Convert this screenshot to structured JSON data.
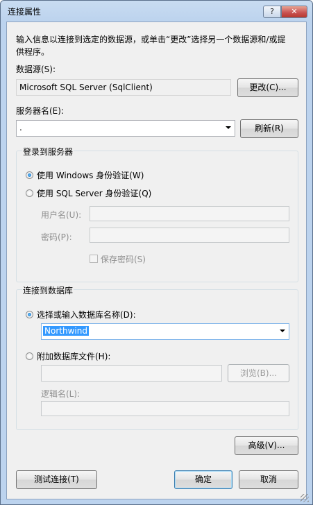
{
  "window": {
    "title": "连接属性",
    "help_label": "?",
    "close_label": "✕"
  },
  "intro": {
    "line1": "输入信息以连接到选定的数据源，或单击“更改”选择另一个数据源和/或提",
    "line2": "供程序。"
  },
  "datasource": {
    "label": "数据源(S):",
    "value": "Microsoft SQL Server (SqlClient)",
    "change_button": "更改(C)..."
  },
  "server": {
    "label": "服务器名(E):",
    "value": ".",
    "refresh_button": "刷新(R)"
  },
  "login": {
    "group_title": "登录到服务器",
    "windows_auth": "使用 Windows 身份验证(W)",
    "sql_auth": "使用 SQL Server 身份验证(Q)",
    "username_label": "用户名(U):",
    "password_label": "密码(P):",
    "save_password": "保存密码(S)"
  },
  "database": {
    "group_title": "连接到数据库",
    "select_label": "选择或输入数据库名称(D):",
    "selected_db": "Northwind",
    "attach_label": "附加数据库文件(H):",
    "browse_button": "浏览(B)...",
    "logical_name_label": "逻辑名(L):"
  },
  "buttons": {
    "advanced": "高级(V)...",
    "test": "测试连接(T)",
    "ok": "确定",
    "cancel": "取消"
  }
}
